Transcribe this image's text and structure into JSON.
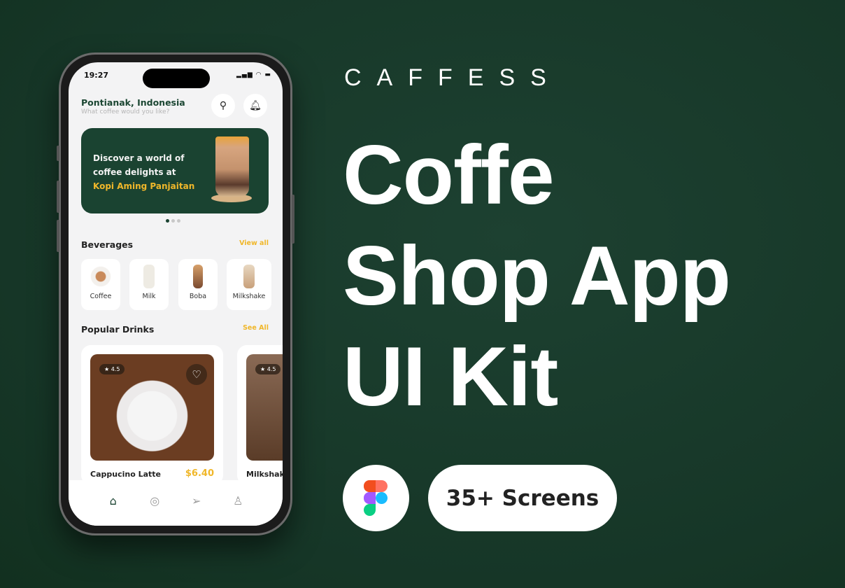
{
  "brand": "CAFFESS",
  "title_lines": [
    "Coffe",
    "Shop App",
    "UI Kit"
  ],
  "screens_badge": "35+ Screens",
  "phone": {
    "time": "19:27",
    "location": "Pontianak, Indonesia",
    "subtitle": "What coffee would you like?",
    "banner": {
      "line1": "Discover a world of",
      "line2": "coffee delights at",
      "highlight": "Kopi Aming Panjaitan"
    },
    "beverages": {
      "title": "Beverages",
      "link": "View all",
      "items": [
        {
          "label": "Coffee"
        },
        {
          "label": "Milk"
        },
        {
          "label": "Boba"
        },
        {
          "label": "Milkshake"
        }
      ]
    },
    "popular": {
      "title": "Popular Drinks",
      "link": "See All",
      "items": [
        {
          "name": "Cappucino Latte",
          "price": "$6.40",
          "rating": "4.5"
        },
        {
          "name": "Milkshak",
          "rating": "4.5"
        }
      ]
    }
  },
  "colors": {
    "background": "#183a2b",
    "accent": "#f0b72a",
    "primary": "#1a4331"
  }
}
